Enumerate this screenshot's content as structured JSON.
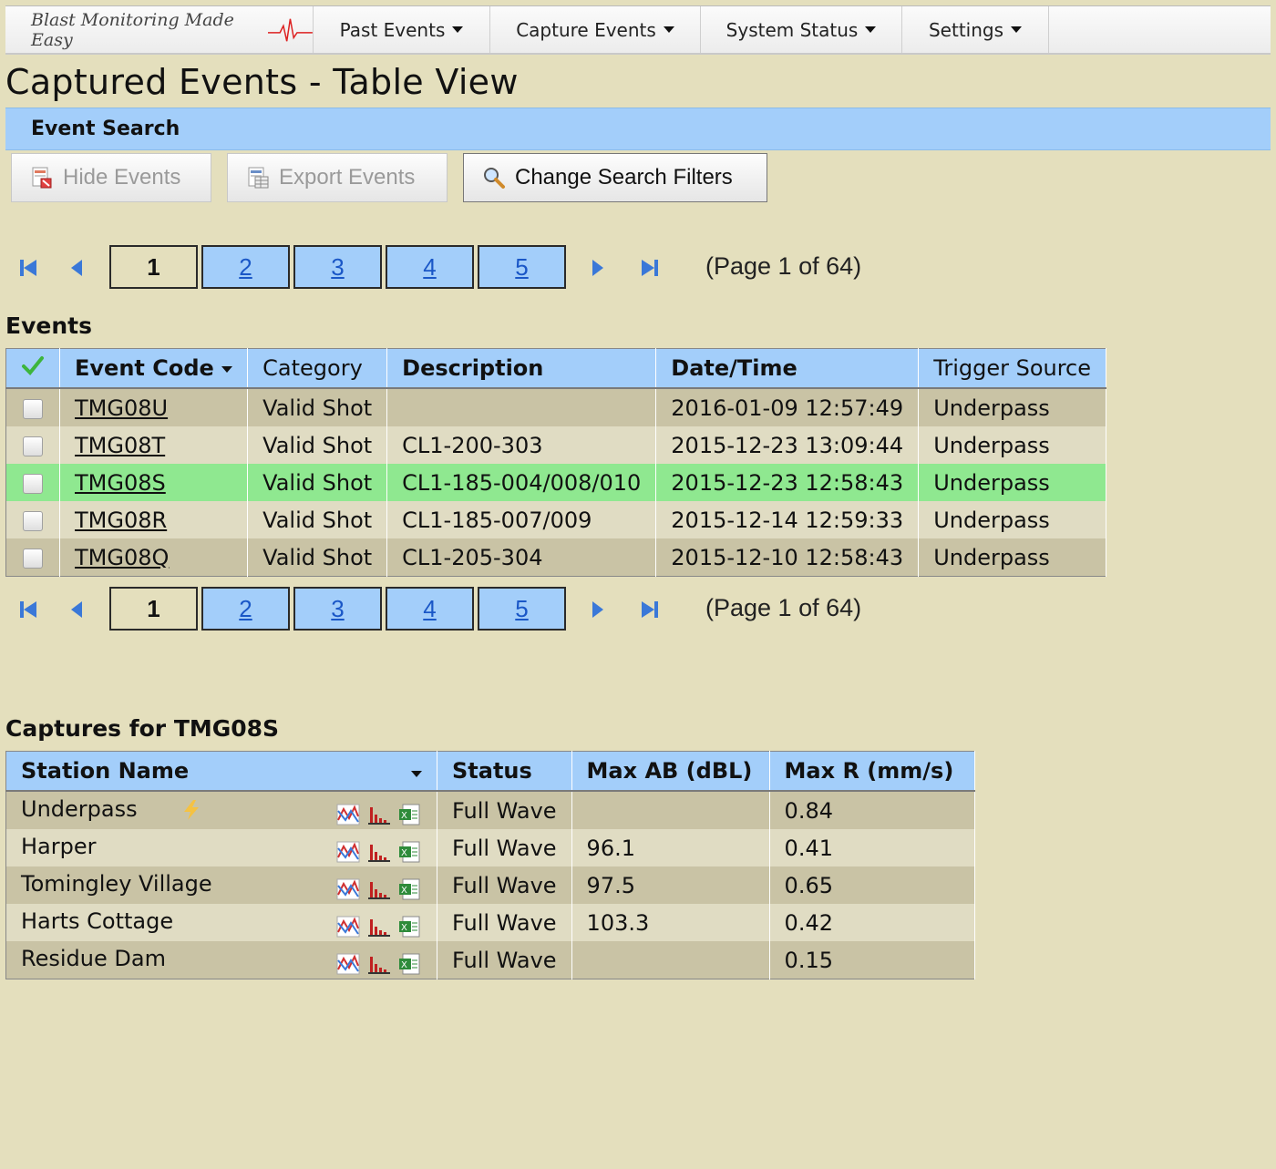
{
  "nav": {
    "brand": "Blast Monitoring Made Easy",
    "items": [
      {
        "label": "Past Events"
      },
      {
        "label": "Capture Events"
      },
      {
        "label": "System Status"
      },
      {
        "label": "Settings"
      }
    ]
  },
  "page_title": "Captured Events - Table View",
  "search_bar": {
    "label": "Event Search"
  },
  "toolbar": {
    "hide_events": "Hide Events",
    "export_events": "Export Events",
    "change_filters": "Change Search Filters"
  },
  "pager": {
    "pages": [
      "1",
      "2",
      "3",
      "4",
      "5"
    ],
    "current": "1",
    "info": "(Page 1 of 64)"
  },
  "events": {
    "heading": "Events",
    "columns": [
      "Event Code",
      "Category",
      "Description",
      "Date/Time",
      "Trigger Source"
    ],
    "rows": [
      {
        "code": "TMG08U",
        "category": "Valid Shot",
        "description": "",
        "datetime": "2016-01-09 12:57:49",
        "trigger": "Underpass"
      },
      {
        "code": "TMG08T",
        "category": "Valid Shot",
        "description": "CL1-200-303",
        "datetime": "2015-12-23 13:09:44",
        "trigger": "Underpass"
      },
      {
        "code": "TMG08S",
        "category": "Valid Shot",
        "description": "CL1-185-004/008/010",
        "datetime": "2015-12-23 12:58:43",
        "trigger": "Underpass"
      },
      {
        "code": "TMG08R",
        "category": "Valid Shot",
        "description": "CL1-185-007/009",
        "datetime": "2015-12-14 12:59:33",
        "trigger": "Underpass"
      },
      {
        "code": "TMG08Q",
        "category": "Valid Shot",
        "description": "CL1-205-304",
        "datetime": "2015-12-10 12:58:43",
        "trigger": "Underpass"
      }
    ]
  },
  "captures": {
    "heading": "Captures for TMG08S",
    "columns": [
      "Station Name",
      "Status",
      "Max AB (dBL)",
      "Max R (mm/s)"
    ],
    "rows": [
      {
        "station": "Underpass",
        "status": "Full Wave",
        "max_ab": "",
        "max_r": "0.84"
      },
      {
        "station": "Harper",
        "status": "Full Wave",
        "max_ab": "96.1",
        "max_r": "0.41"
      },
      {
        "station": "Tomingley Village",
        "status": "Full Wave",
        "max_ab": "97.5",
        "max_r": "0.65"
      },
      {
        "station": "Harts Cottage",
        "status": "Full Wave",
        "max_ab": "103.3",
        "max_r": "0.42"
      },
      {
        "station": "Residue Dam",
        "status": "Full Wave",
        "max_ab": "",
        "max_r": "0.15"
      }
    ]
  }
}
